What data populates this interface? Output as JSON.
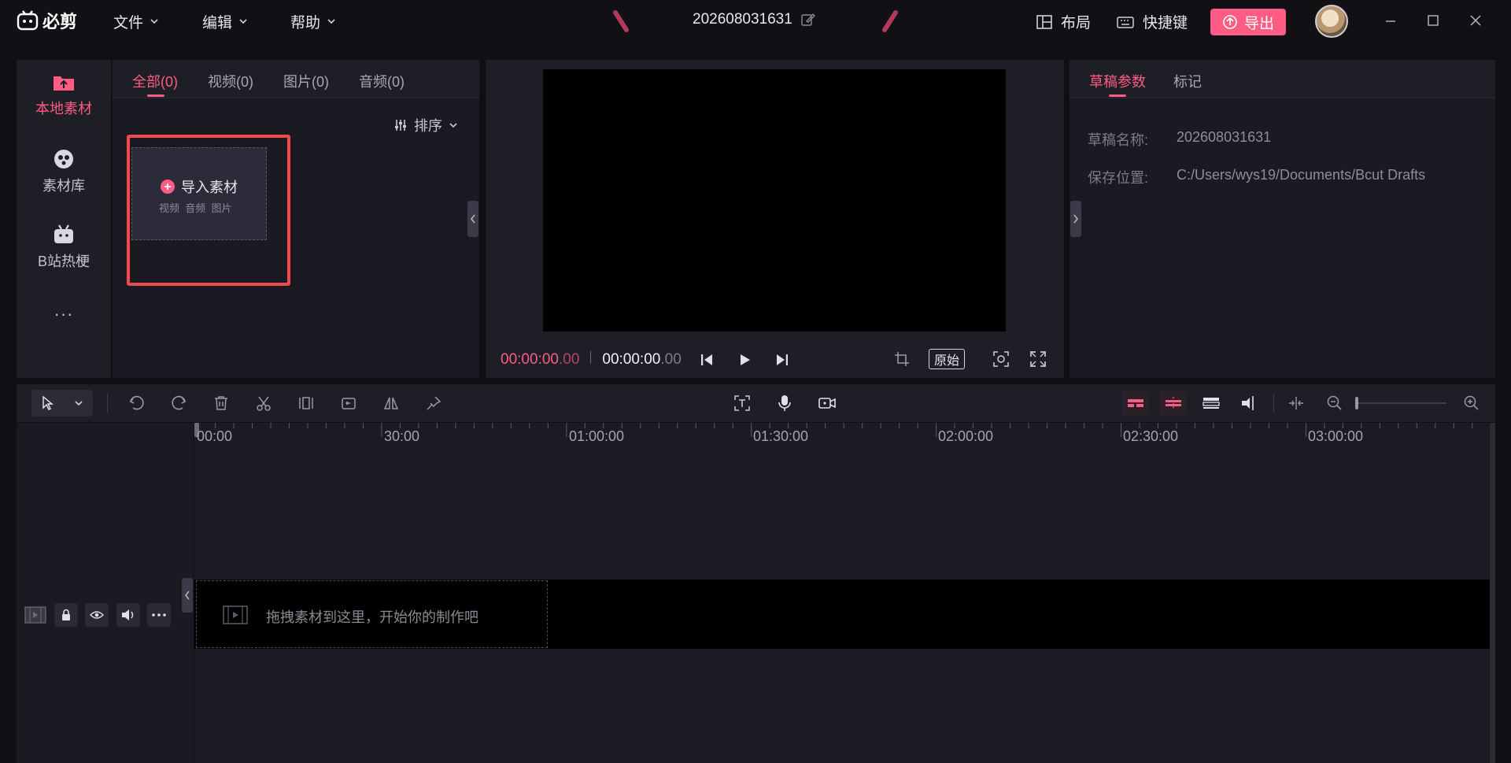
{
  "app": {
    "logo_text": "必剪",
    "project_name": "202608031631",
    "menu": [
      {
        "label": "文件"
      },
      {
        "label": "编辑"
      },
      {
        "label": "帮助"
      }
    ],
    "layout_label": "布局",
    "shortcut_label": "快捷键",
    "export_label": "导出"
  },
  "sidebar": {
    "items": [
      {
        "label": "本地素材",
        "active": true
      },
      {
        "label": "素材库"
      },
      {
        "label": "B站热梗"
      }
    ],
    "more_label": "···"
  },
  "media": {
    "tabs": [
      {
        "label": "全部(0)",
        "active": true
      },
      {
        "label": "视频(0)"
      },
      {
        "label": "图片(0)"
      },
      {
        "label": "音频(0)"
      }
    ],
    "sort_label": "排序",
    "import_title": "导入素材",
    "import_subtitle": "视频  音频  图片"
  },
  "preview": {
    "current_time": "00:00:00",
    "current_frames": ".00",
    "total_time": "00:00:00",
    "total_frames": ".00",
    "ratio_label": "原始"
  },
  "properties": {
    "tabs": [
      {
        "label": "草稿参数",
        "active": true
      },
      {
        "label": "标记"
      }
    ],
    "fields": [
      {
        "label": "草稿名称:",
        "value": "202608031631"
      },
      {
        "label": "保存位置:",
        "value": "C:/Users/wys19/Documents/Bcut Drafts"
      }
    ]
  },
  "timeline": {
    "ruler": [
      "00:00",
      "30:00",
      "01:00:00",
      "01:30:00",
      "02:00:00",
      "02:30:00",
      "03:00:00"
    ],
    "drop_hint": "拖拽素材到这里，开始你的制作吧"
  },
  "colors": {
    "accent": "#fe5c84",
    "bg": "#0f0f14",
    "panel": "#1e1e27"
  }
}
